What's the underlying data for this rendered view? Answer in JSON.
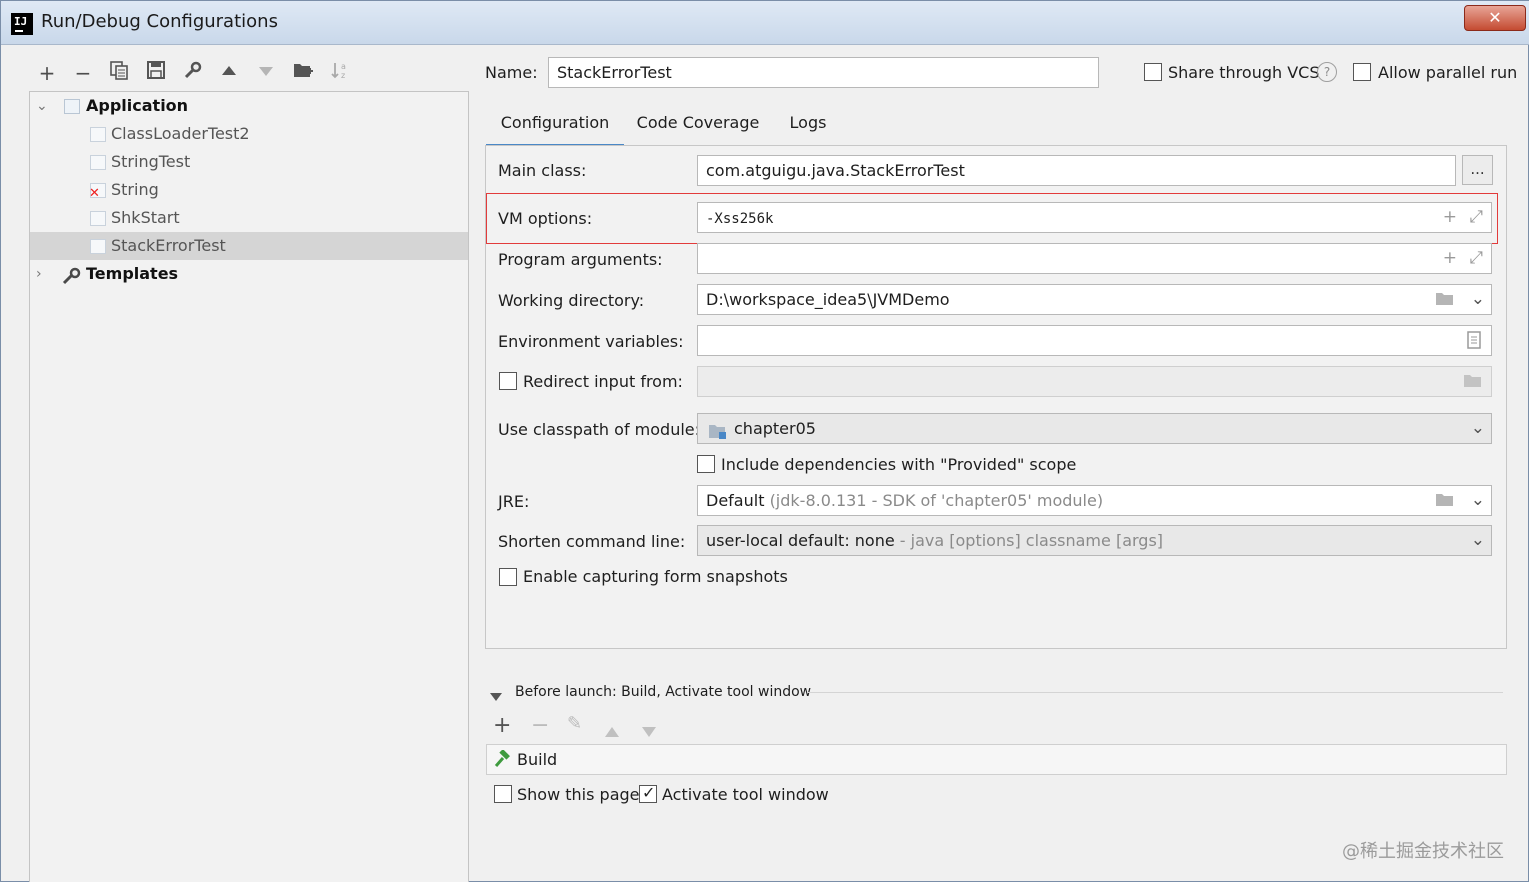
{
  "window": {
    "title": "Run/Debug Configurations",
    "app_icon": "IJ",
    "close_label": "✕"
  },
  "toolbar": {
    "icons": [
      "add-icon",
      "remove-icon",
      "copy-icon",
      "save-icon",
      "wrench-icon",
      "move-up-icon",
      "move-down-icon",
      "new-folder-icon",
      "sort-icon"
    ]
  },
  "tree": {
    "application": "Application",
    "items": [
      {
        "label": "ClassLoaderTest2",
        "error": false,
        "selected": false
      },
      {
        "label": "StringTest",
        "error": false,
        "selected": false
      },
      {
        "label": "String",
        "error": true,
        "selected": false
      },
      {
        "label": "ShkStart",
        "error": false,
        "selected": false
      },
      {
        "label": "StackErrorTest",
        "error": false,
        "selected": true
      }
    ],
    "templates": "Templates"
  },
  "header": {
    "name_label": "Name:",
    "name_value": "StackErrorTest",
    "share_vcs_label": "Share through VCS",
    "share_vcs_checked": false,
    "help_label": "?",
    "allow_parallel_label": "Allow parallel run",
    "allow_parallel_checked": false
  },
  "tabs": [
    {
      "label": "Configuration",
      "active": true
    },
    {
      "label": "Code Coverage",
      "active": false
    },
    {
      "label": "Logs",
      "active": false
    }
  ],
  "form": {
    "main_class_label": "Main class:",
    "main_class_value": "com.atguigu.java.StackErrorTest",
    "browse_label": "...",
    "vm_options_label": "VM options:",
    "vm_options_value": "-Xss256k",
    "program_args_label": "Program arguments:",
    "program_args_value": "",
    "working_dir_label": "Working directory:",
    "working_dir_value": "D:\\workspace_idea5\\JVMDemo",
    "env_vars_label": "Environment variables:",
    "env_vars_value": "",
    "redirect_label": "Redirect input from:",
    "redirect_checked": false,
    "classpath_label": "Use classpath of module:",
    "classpath_value": "chapter05",
    "include_deps_label": "Include dependencies with \"Provided\" scope",
    "include_deps_checked": false,
    "jre_label": "JRE:",
    "jre_value": "Default",
    "jre_hint": "(jdk-8.0.131 - SDK of 'chapter05' module)",
    "shorten_label": "Shorten command line:",
    "shorten_value": "user-local default: none",
    "shorten_hint": "- java [options] classname [args]",
    "snapshots_label": "Enable capturing form snapshots",
    "snapshots_checked": false
  },
  "before_launch": {
    "header": "Before launch: Build, Activate tool window",
    "tools": [
      "add-icon",
      "remove-icon",
      "edit-icon",
      "move-up-icon",
      "move-down-icon"
    ],
    "items": [
      "Build"
    ],
    "show_page_label": "Show this page",
    "show_page_checked": false,
    "activate_label": "Activate tool window",
    "activate_checked": true
  },
  "watermark": "@稀土掘金技术社区",
  "colors": {
    "highlight_border": "#e23b3b",
    "active_tab": "#4a88c7",
    "error_mark": "#e22222"
  }
}
